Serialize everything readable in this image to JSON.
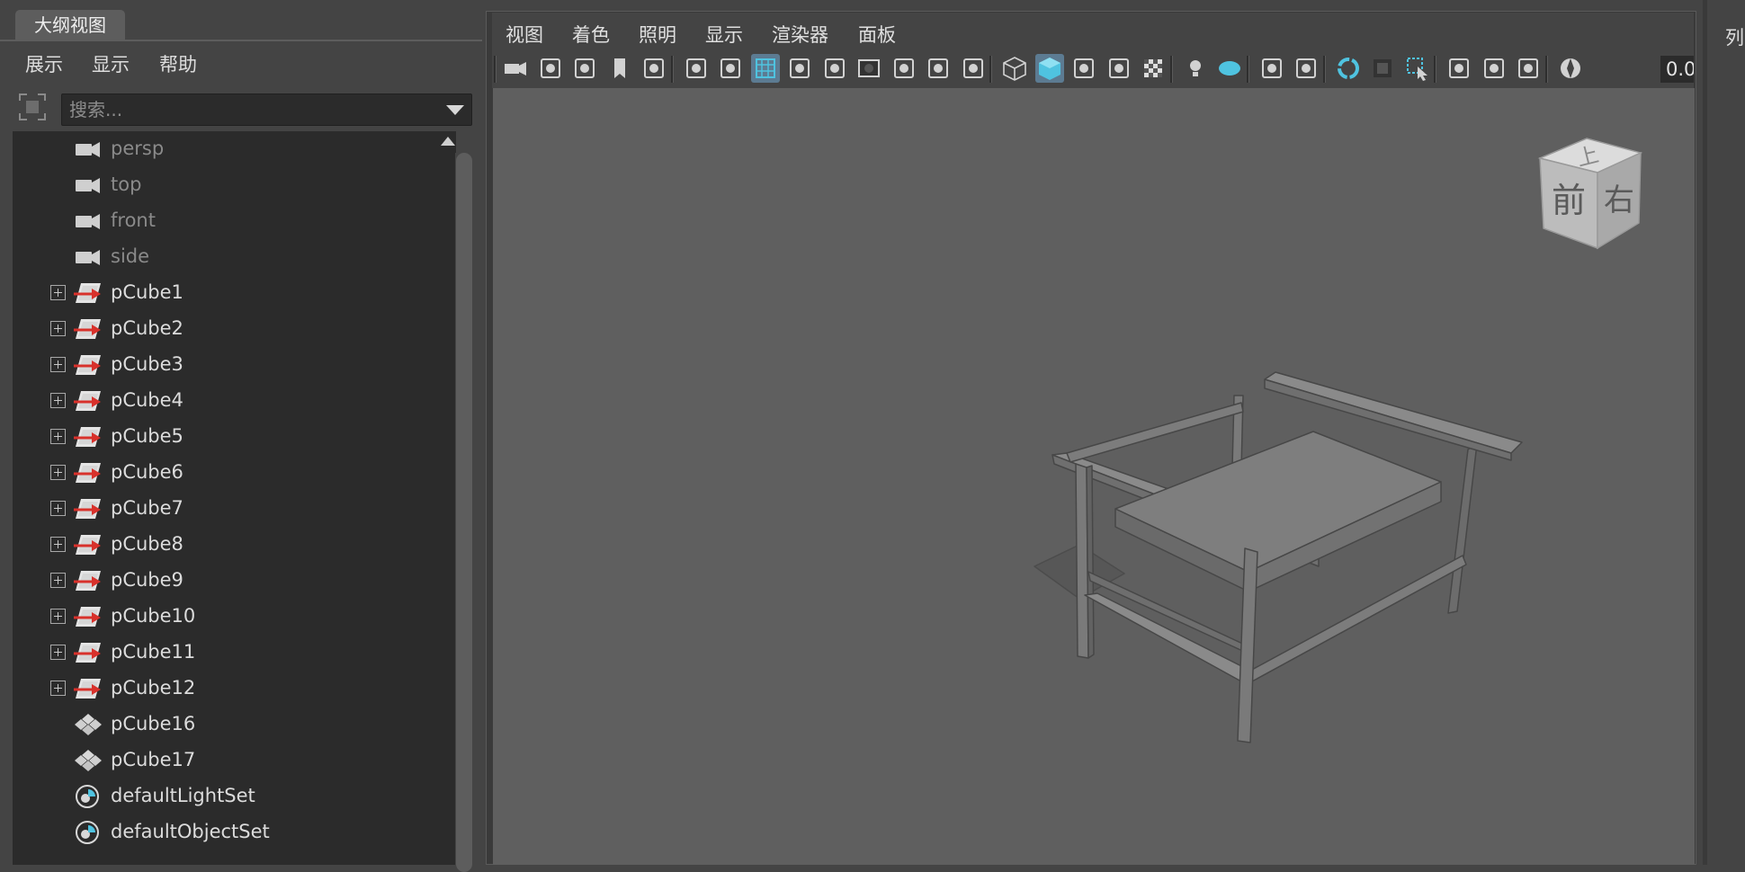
{
  "outliner": {
    "tab_title": "大纲视图",
    "menu": [
      "展示",
      "显示",
      "帮助"
    ],
    "search_placeholder": "搜索...",
    "items": [
      {
        "label": "persp",
        "kind": "camera"
      },
      {
        "label": "top",
        "kind": "camera"
      },
      {
        "label": "front",
        "kind": "camera"
      },
      {
        "label": "side",
        "kind": "camera"
      },
      {
        "label": "pCube1",
        "kind": "transform",
        "expandable": true
      },
      {
        "label": "pCube2",
        "kind": "transform",
        "expandable": true
      },
      {
        "label": "pCube3",
        "kind": "transform",
        "expandable": true
      },
      {
        "label": "pCube4",
        "kind": "transform",
        "expandable": true
      },
      {
        "label": "pCube5",
        "kind": "transform",
        "expandable": true
      },
      {
        "label": "pCube6",
        "kind": "transform",
        "expandable": true
      },
      {
        "label": "pCube7",
        "kind": "transform",
        "expandable": true
      },
      {
        "label": "pCube8",
        "kind": "transform",
        "expandable": true
      },
      {
        "label": "pCube9",
        "kind": "transform",
        "expandable": true
      },
      {
        "label": "pCube10",
        "kind": "transform",
        "expandable": true
      },
      {
        "label": "pCube11",
        "kind": "transform",
        "expandable": true
      },
      {
        "label": "pCube12",
        "kind": "transform",
        "expandable": true
      },
      {
        "label": "pCube16",
        "kind": "mesh"
      },
      {
        "label": "pCube17",
        "kind": "mesh"
      },
      {
        "label": "defaultLightSet",
        "kind": "set"
      },
      {
        "label": "defaultObjectSet",
        "kind": "set"
      }
    ]
  },
  "viewport": {
    "menu": [
      "视图",
      "着色",
      "照明",
      "显示",
      "渲染器",
      "面板"
    ],
    "toolbar_value": "0.0",
    "view_cube": {
      "top": "上",
      "front": "前",
      "right": "右"
    },
    "toolbar_icons": [
      "select-camera-icon",
      "lock-camera-icon",
      "camera-attributes-icon",
      "bookmark-icon",
      "image-plane-icon",
      "2d-pan-zoom-icon",
      "grease-pencil-icon",
      "grid-icon",
      "film-gate-icon",
      "resolution-gate-icon",
      "gate-mask-icon",
      "field-chart-icon",
      "safe-action-icon",
      "safe-title-icon",
      "wireframe-icon",
      "smooth-shade-icon",
      "use-default-material-icon",
      "wireframe-on-shaded-icon",
      "textured-icon",
      "use-all-lights-icon",
      "shadows-icon",
      "screen-space-ao-icon",
      "motion-blur-icon",
      "anti-aliasing-icon",
      "depth-of-field-icon",
      "isolate-select-icon",
      "xray-icon",
      "xray-joints-icon",
      "xray-active-icon",
      "exposure-icon"
    ]
  },
  "right_panel": {
    "label": "列"
  },
  "colors": {
    "accent": "#5c7b92",
    "active_icon": "#4fc3e0",
    "panel": "#444444",
    "tree_bg": "#2b2b2b",
    "viewport_bg": "#5f5f5f"
  }
}
